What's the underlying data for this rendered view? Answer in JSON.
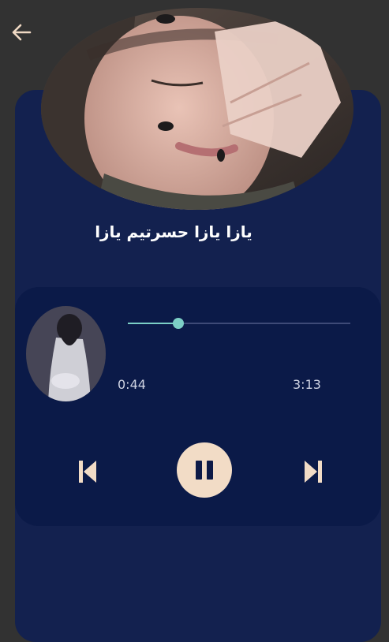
{
  "header": {
    "back_icon": "arrow-left-icon"
  },
  "song": {
    "title": "يازا يازا حسرتيم يازا"
  },
  "player": {
    "current_time": "0:44",
    "total_time": "3:13",
    "progress_fraction": 0.227,
    "state": "playing",
    "prev_icon": "skip-previous-icon",
    "pause_icon": "pause-icon",
    "next_icon": "skip-next-icon"
  },
  "colors": {
    "background": "#323232",
    "card": "#13214f",
    "player_panel": "#0b1a48",
    "accent": "#7ccfc6",
    "button": "#f2dcc6"
  }
}
